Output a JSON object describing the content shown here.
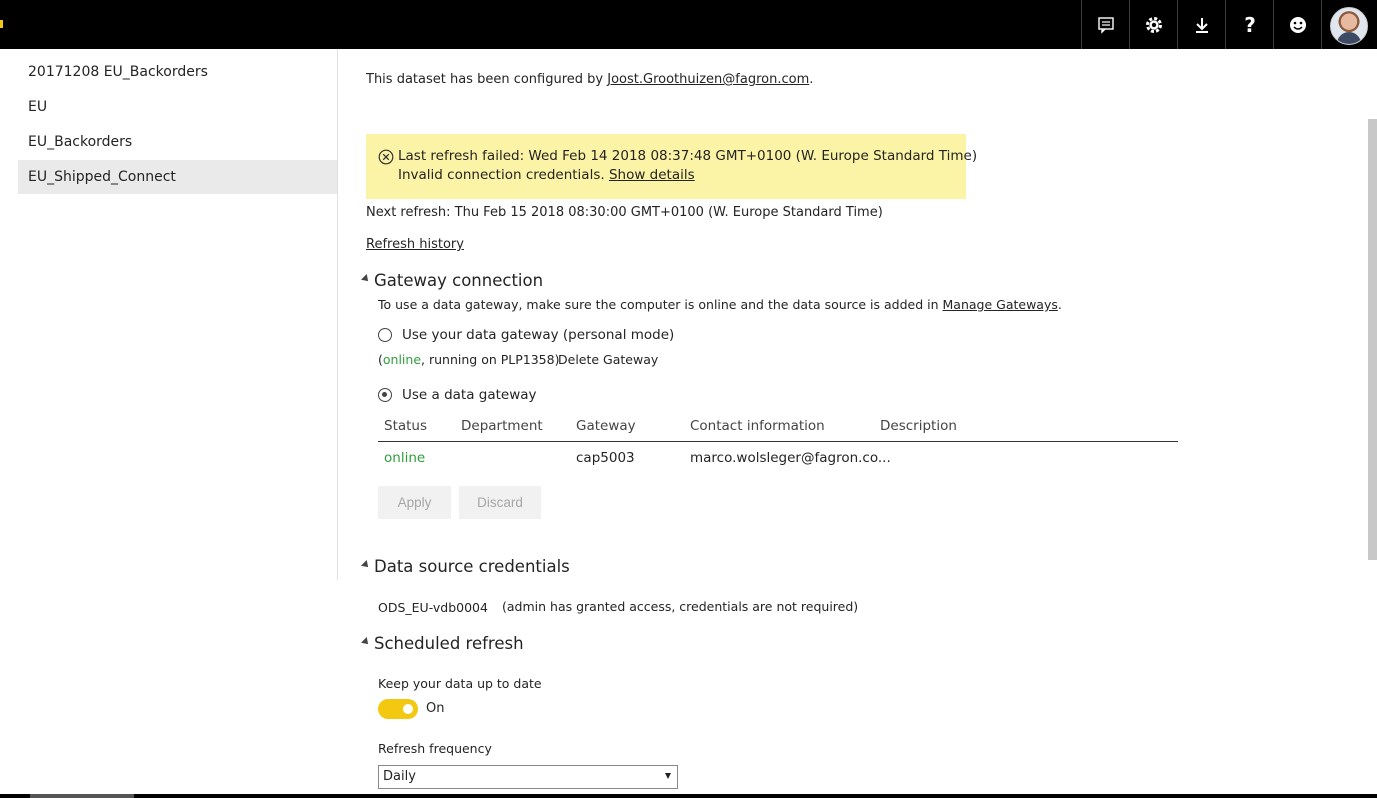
{
  "topbar": {
    "icons": [
      "feedback-icon",
      "gear-icon",
      "download-icon",
      "help-icon",
      "smiley-icon"
    ]
  },
  "sidebar": {
    "items": [
      {
        "label": "20171208 EU_Backorders"
      },
      {
        "label": "EU"
      },
      {
        "label": "EU_Backorders"
      },
      {
        "label": "EU_Shipped_Connect",
        "active": true
      }
    ]
  },
  "configured": {
    "prefix": "This dataset has been configured by ",
    "email": "Joost.Groothuizen@fagron.com",
    "suffix": "."
  },
  "alert": {
    "line1": "Last refresh failed: Wed Feb 14 2018 08:37:48 GMT+0100 (W. Europe Standard Time)",
    "line2": "Invalid connection credentials.",
    "details_link": "Show details",
    "color": "#fbf3a5"
  },
  "next_refresh": "Next refresh: Thu Feb 15 2018 08:30:00 GMT+0100 (W. Europe Standard Time)",
  "refresh_history": "Refresh history",
  "gateway": {
    "title": "Gateway connection",
    "desc_prefix": "To use a data gateway, make sure the computer is online and the data source is added in ",
    "manage_link": "Manage Gateways",
    "desc_suffix": ".",
    "personal_option": "Use your data gateway (personal mode)",
    "personal_status_open": "(",
    "personal_status_online": "online",
    "personal_status_rest": ", running on PLP1358)",
    "delete_gateway": "Delete Gateway",
    "gateway_option": "Use a data gateway",
    "columns": [
      "Status",
      "Department",
      "Gateway",
      "Contact information",
      "Description"
    ],
    "row": {
      "status": "online",
      "department": "",
      "gateway": "cap5003",
      "contact": "marco.wolsleger@fagron.co...",
      "description": ""
    },
    "apply": "Apply",
    "discard": "Discard",
    "status_color": "#2f9e3b"
  },
  "credentials": {
    "title": "Data source credentials",
    "source": "ODS_EU-vdb0004",
    "note": "(admin has granted access, credentials are not required)"
  },
  "scheduled": {
    "title": "Scheduled refresh",
    "keep_label": "Keep your data up to date",
    "toggle_state": "On",
    "frequency_label": "Refresh frequency",
    "frequency_value": "Daily",
    "toggle_color": "#f2c811"
  }
}
